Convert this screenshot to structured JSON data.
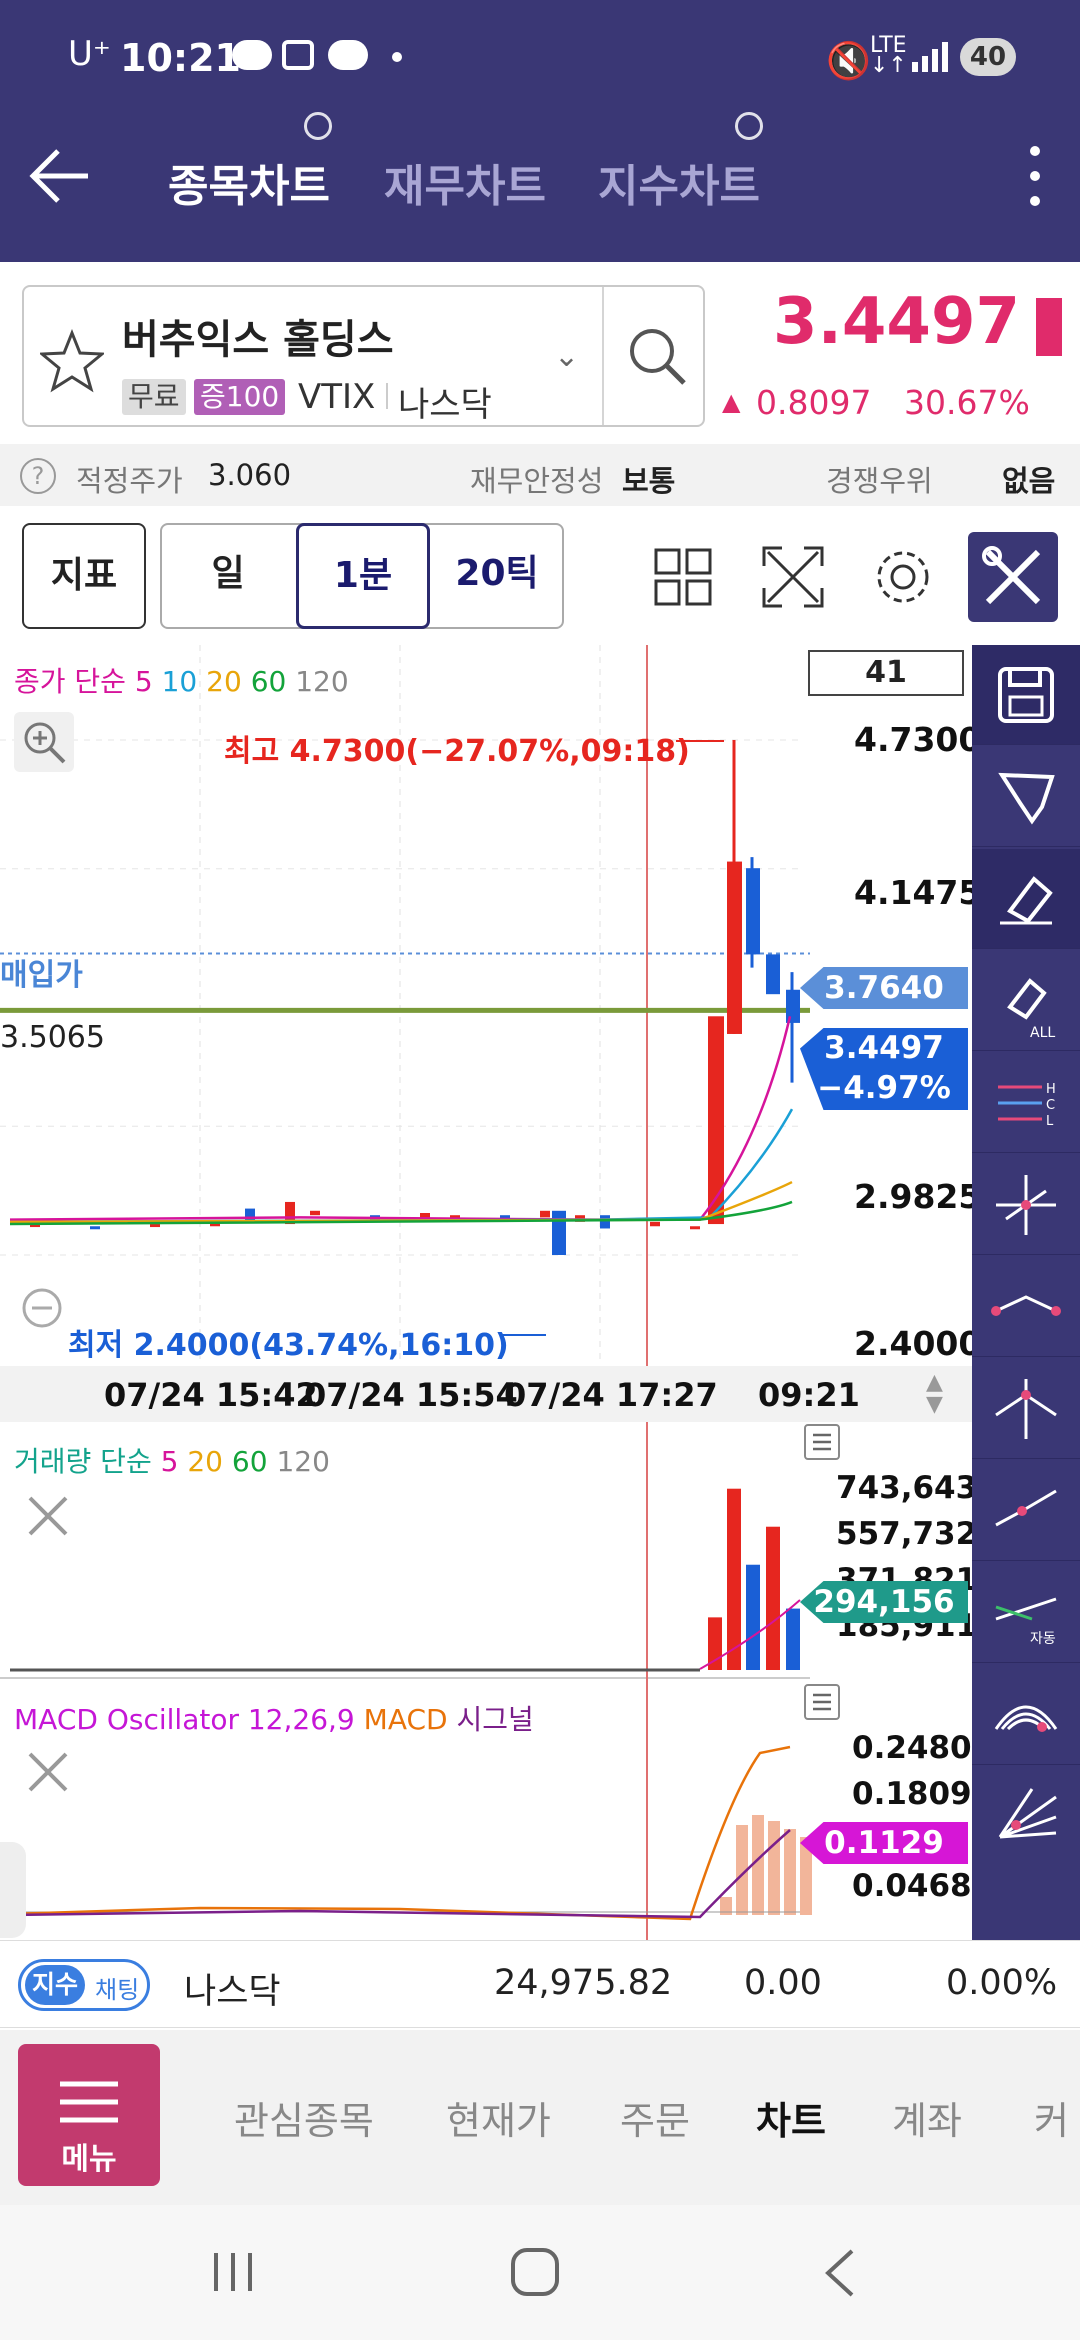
{
  "status_bar": {
    "carrier": "U⁺",
    "time": "10:21",
    "battery": "40"
  },
  "header": {
    "tabs": [
      {
        "label": "종목차트",
        "active": true
      },
      {
        "label": "재무차트",
        "active": false
      },
      {
        "label": "지수차트",
        "active": false
      }
    ]
  },
  "stock": {
    "name": "버추익스 홀딩스",
    "badge_free": "무료",
    "badge_margin": "증100",
    "ticker": "VTIX",
    "market": "나스닥",
    "price": "3.4497",
    "change": "0.8097",
    "change_pct": "30.67%"
  },
  "info_row": {
    "fair_price_label": "적정주가",
    "fair_price_value": "3.060",
    "stability_label": "재무안정성",
    "stability_value": "보통",
    "competitive_label": "경쟁우위",
    "competitive_value": "없음"
  },
  "toolbar": {
    "indicator_btn": "지표",
    "period_day": "일",
    "period_minute": "1분",
    "period_tick": "20틱"
  },
  "chart": {
    "legend_price": {
      "name": "종가 단순",
      "p5": "5",
      "p10": "10",
      "p20": "20",
      "p60": "60",
      "p120": "120"
    },
    "count_box": "41",
    "high_label": "최고 4.7300(−27.07%,09:18)",
    "low_label": "최저 2.4000(43.74%,16:10)",
    "buy_label": "매입가",
    "line_label": "3.5065",
    "y_ticks": [
      "4.7300",
      "4.1475",
      "2.9825",
      "2.4000"
    ],
    "buy_price_tag": "3.7640",
    "current_price_tag": "3.4497",
    "current_pct_tag": "−4.97%",
    "x_ticks": [
      "07/24 15:42",
      "07/24 15:54",
      "07/24 17:27",
      "09:21"
    ],
    "colors": {
      "up": "#e6261f",
      "down": "#1a5fd6",
      "ma5": "#d6149b",
      "ma10": "#1aa0d6",
      "ma20": "#e8a50a",
      "ma60": "#13a33a",
      "ma120": "#888888"
    }
  },
  "volume": {
    "legend": {
      "name": "거래량 단순",
      "p5": "5",
      "p20": "20",
      "p60": "60",
      "p120": "120"
    },
    "ticks": [
      "743,643",
      "557,732",
      "371,821",
      "185,911"
    ],
    "current_tag": "294,156"
  },
  "macd": {
    "legend": {
      "name": "MACD Oscillator 12,26,9",
      "macd": "MACD",
      "signal": "시그널"
    },
    "ticks": [
      "0.2480",
      "0.1809",
      "0.0468"
    ],
    "current_tag": "0.1129"
  },
  "index_row": {
    "badge_a": "지수",
    "badge_b": "채팅",
    "name": "나스닥",
    "value": "24,975.82",
    "change": "0.00",
    "pct": "0.00%"
  },
  "bottom_nav": {
    "menu_label": "메뉴",
    "items": [
      "관심종목",
      "현재가",
      "주문",
      "차트",
      "계좌",
      "커"
    ],
    "active_index": 3
  },
  "chart_data": {
    "type": "candlestick",
    "title": "",
    "ylim": [
      2.4,
      4.73
    ],
    "y_ticks": [
      4.73,
      4.1475,
      2.9825,
      2.4
    ],
    "x_ticks": [
      "07/24 15:42",
      "07/24 15:54",
      "07/24 17:27",
      "09:21"
    ],
    "reference_lines": [
      {
        "label": "매입가",
        "value": 3.764
      },
      {
        "label": "",
        "value": 3.5065
      }
    ],
    "annotations": [
      {
        "text": "최고 4.7300(−27.07%,09:18)",
        "value": 4.73
      },
      {
        "text": "최저 2.4000(43.74%,16:10)",
        "value": 2.4
      }
    ],
    "last_price": 3.4497
  }
}
